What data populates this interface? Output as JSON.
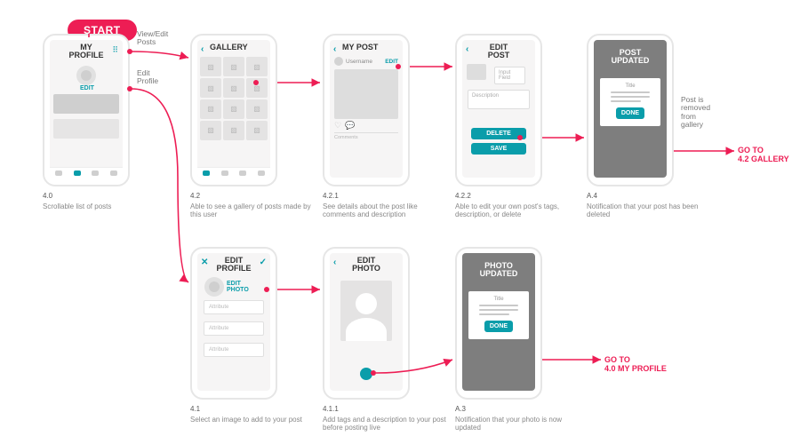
{
  "start": "START",
  "labels": {
    "view_edit_posts": "View/Edit\nPosts",
    "edit_profile": "Edit\nProfile",
    "post_removed": "Post is\nremoved\nfrom\ngallery"
  },
  "goto": {
    "gallery": "GO TO\n4.2 GALLERY",
    "profile": "GO TO\n4.0 MY PROFILE"
  },
  "screens": {
    "s40": {
      "title": "MY\nPROFILE",
      "edit": "EDIT"
    },
    "s42": {
      "title": "GALLERY"
    },
    "s421": {
      "title": "MY POST",
      "username": "Username",
      "edit": "EDIT",
      "comments": "Comments"
    },
    "s422": {
      "title": "EDIT\nPOST",
      "input": "Input Field",
      "desc": "Description",
      "delete": "DELETE",
      "save": "SAVE"
    },
    "sA4": {
      "title": "POST\nUPDATED",
      "mtitle": "Title",
      "done": "DONE"
    },
    "s41": {
      "title": "EDIT\nPROFILE",
      "editphoto": "EDIT\nPHOTO",
      "attr": "Attribute"
    },
    "s411": {
      "title": "EDIT\nPHOTO"
    },
    "sA3": {
      "title": "PHOTO\nUPDATED",
      "mtitle": "Title",
      "done": "DONE"
    }
  },
  "captions": {
    "c40": {
      "num": "4.0",
      "text": "Scrollable list of posts"
    },
    "c42": {
      "num": "4.2",
      "text": "Able to see a gallery of posts made by this user"
    },
    "c421": {
      "num": "4.2.1",
      "text": "See details about the post like comments and description"
    },
    "c422": {
      "num": "4.2.2",
      "text": "Able to edit your own post's tags, description, or delete"
    },
    "cA4": {
      "num": "A.4",
      "text": "Notification that your post has been deleted"
    },
    "c41": {
      "num": "4.1",
      "text": "Select an image to add to your post"
    },
    "c411": {
      "num": "4.1.1",
      "text": "Add tags and a description to your post before posting live"
    },
    "cA3": {
      "num": "A.3",
      "text": "Notification that your photo is now updated"
    }
  }
}
